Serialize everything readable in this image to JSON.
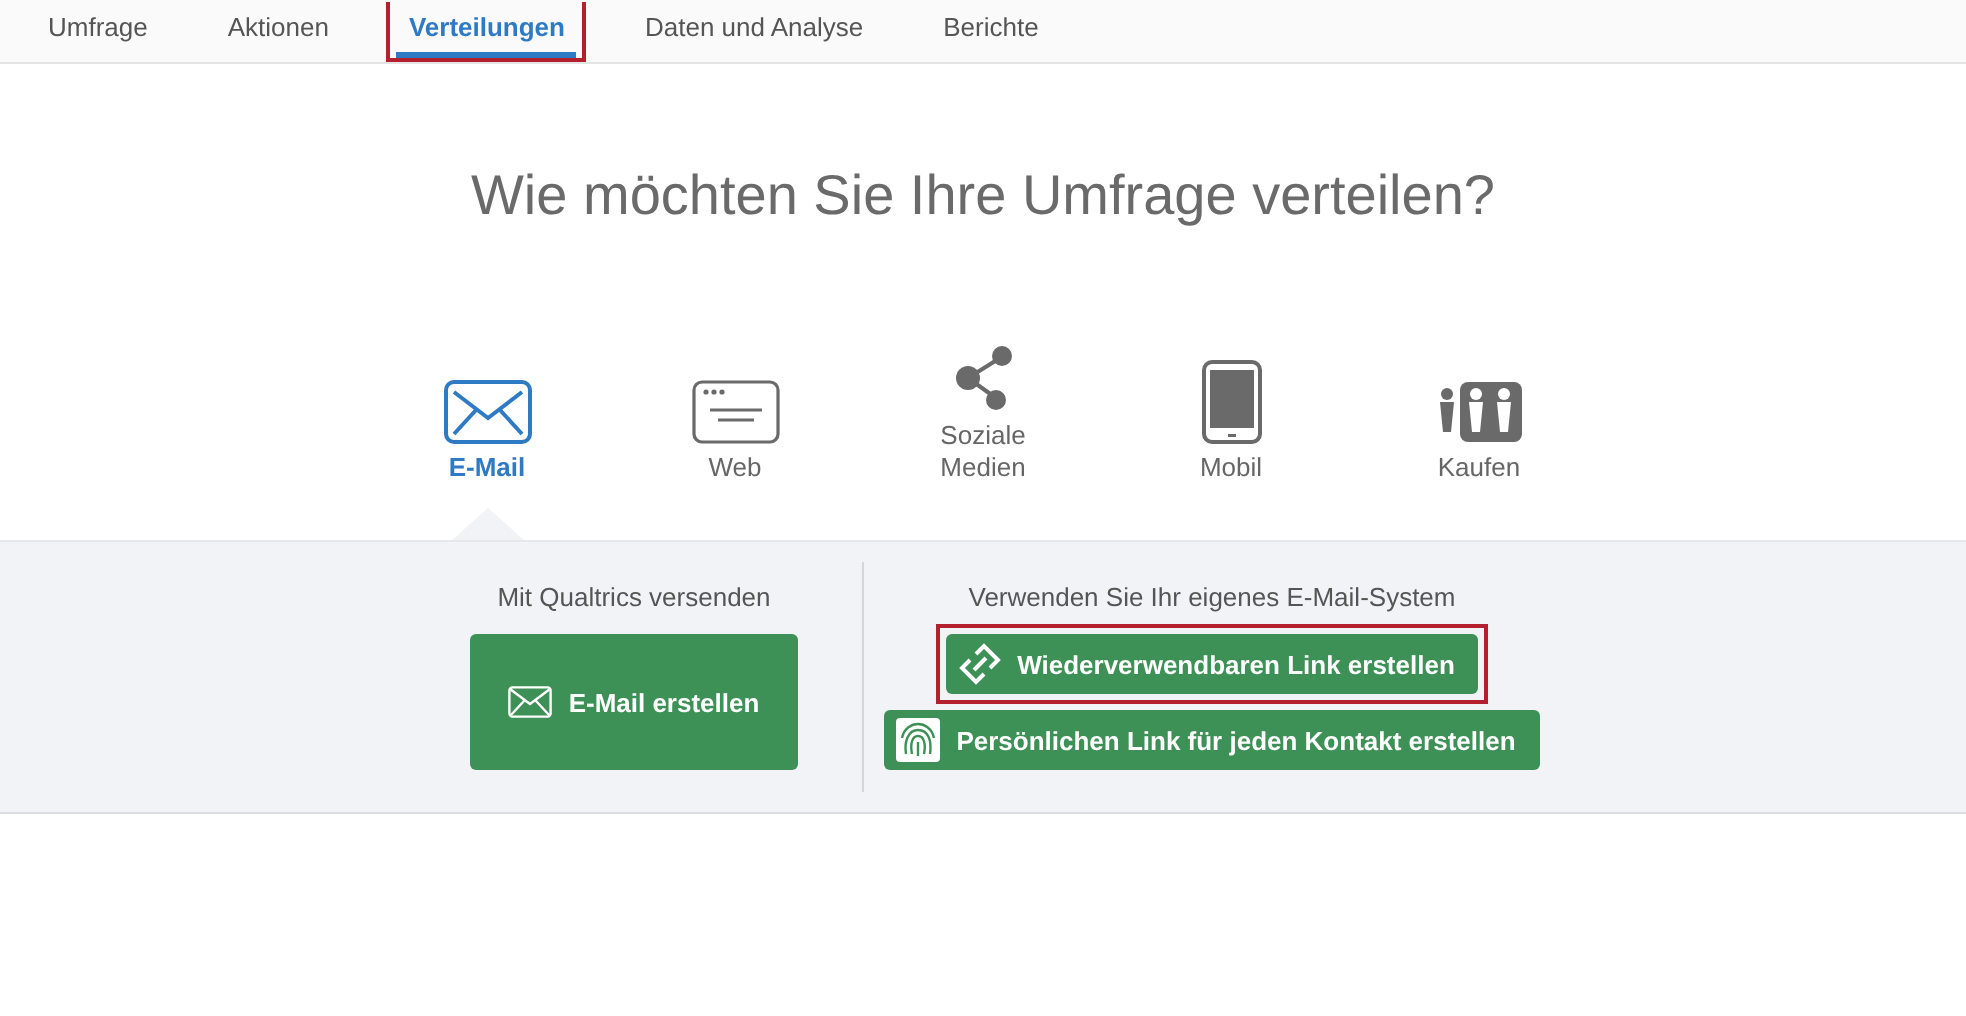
{
  "tabs": [
    {
      "label": "Umfrage",
      "selected": false,
      "highlighted": false
    },
    {
      "label": "Aktionen",
      "selected": false,
      "highlighted": false
    },
    {
      "label": "Verteilungen",
      "selected": true,
      "highlighted": true
    },
    {
      "label": "Daten und Analyse",
      "selected": false,
      "highlighted": false
    },
    {
      "label": "Berichte",
      "selected": false,
      "highlighted": false
    }
  ],
  "heading": "Wie möchten Sie Ihre Umfrage verteilen?",
  "channels": [
    {
      "kind": "email",
      "label": "E-Mail",
      "selected": true
    },
    {
      "kind": "web",
      "label": "Web",
      "selected": false
    },
    {
      "kind": "social",
      "label": "Soziale Medien",
      "selected": false
    },
    {
      "kind": "mobile",
      "label": "Mobil",
      "selected": false
    },
    {
      "kind": "buy",
      "label": "Kaufen",
      "selected": false
    }
  ],
  "panel": {
    "left": {
      "title": "Mit Qualtrics versenden",
      "button": {
        "kind": "envelope",
        "label": "E-Mail erstellen",
        "highlighted": false
      }
    },
    "right": {
      "title": "Verwenden Sie Ihr eigenes E-Mail-System",
      "buttons": [
        {
          "kind": "link",
          "label": "Wiederverwendbaren Link erstellen",
          "highlighted": true
        },
        {
          "kind": "fingerprint",
          "label": "Persönlichen Link für jeden Kontakt erstellen",
          "highlighted": false
        }
      ]
    }
  }
}
